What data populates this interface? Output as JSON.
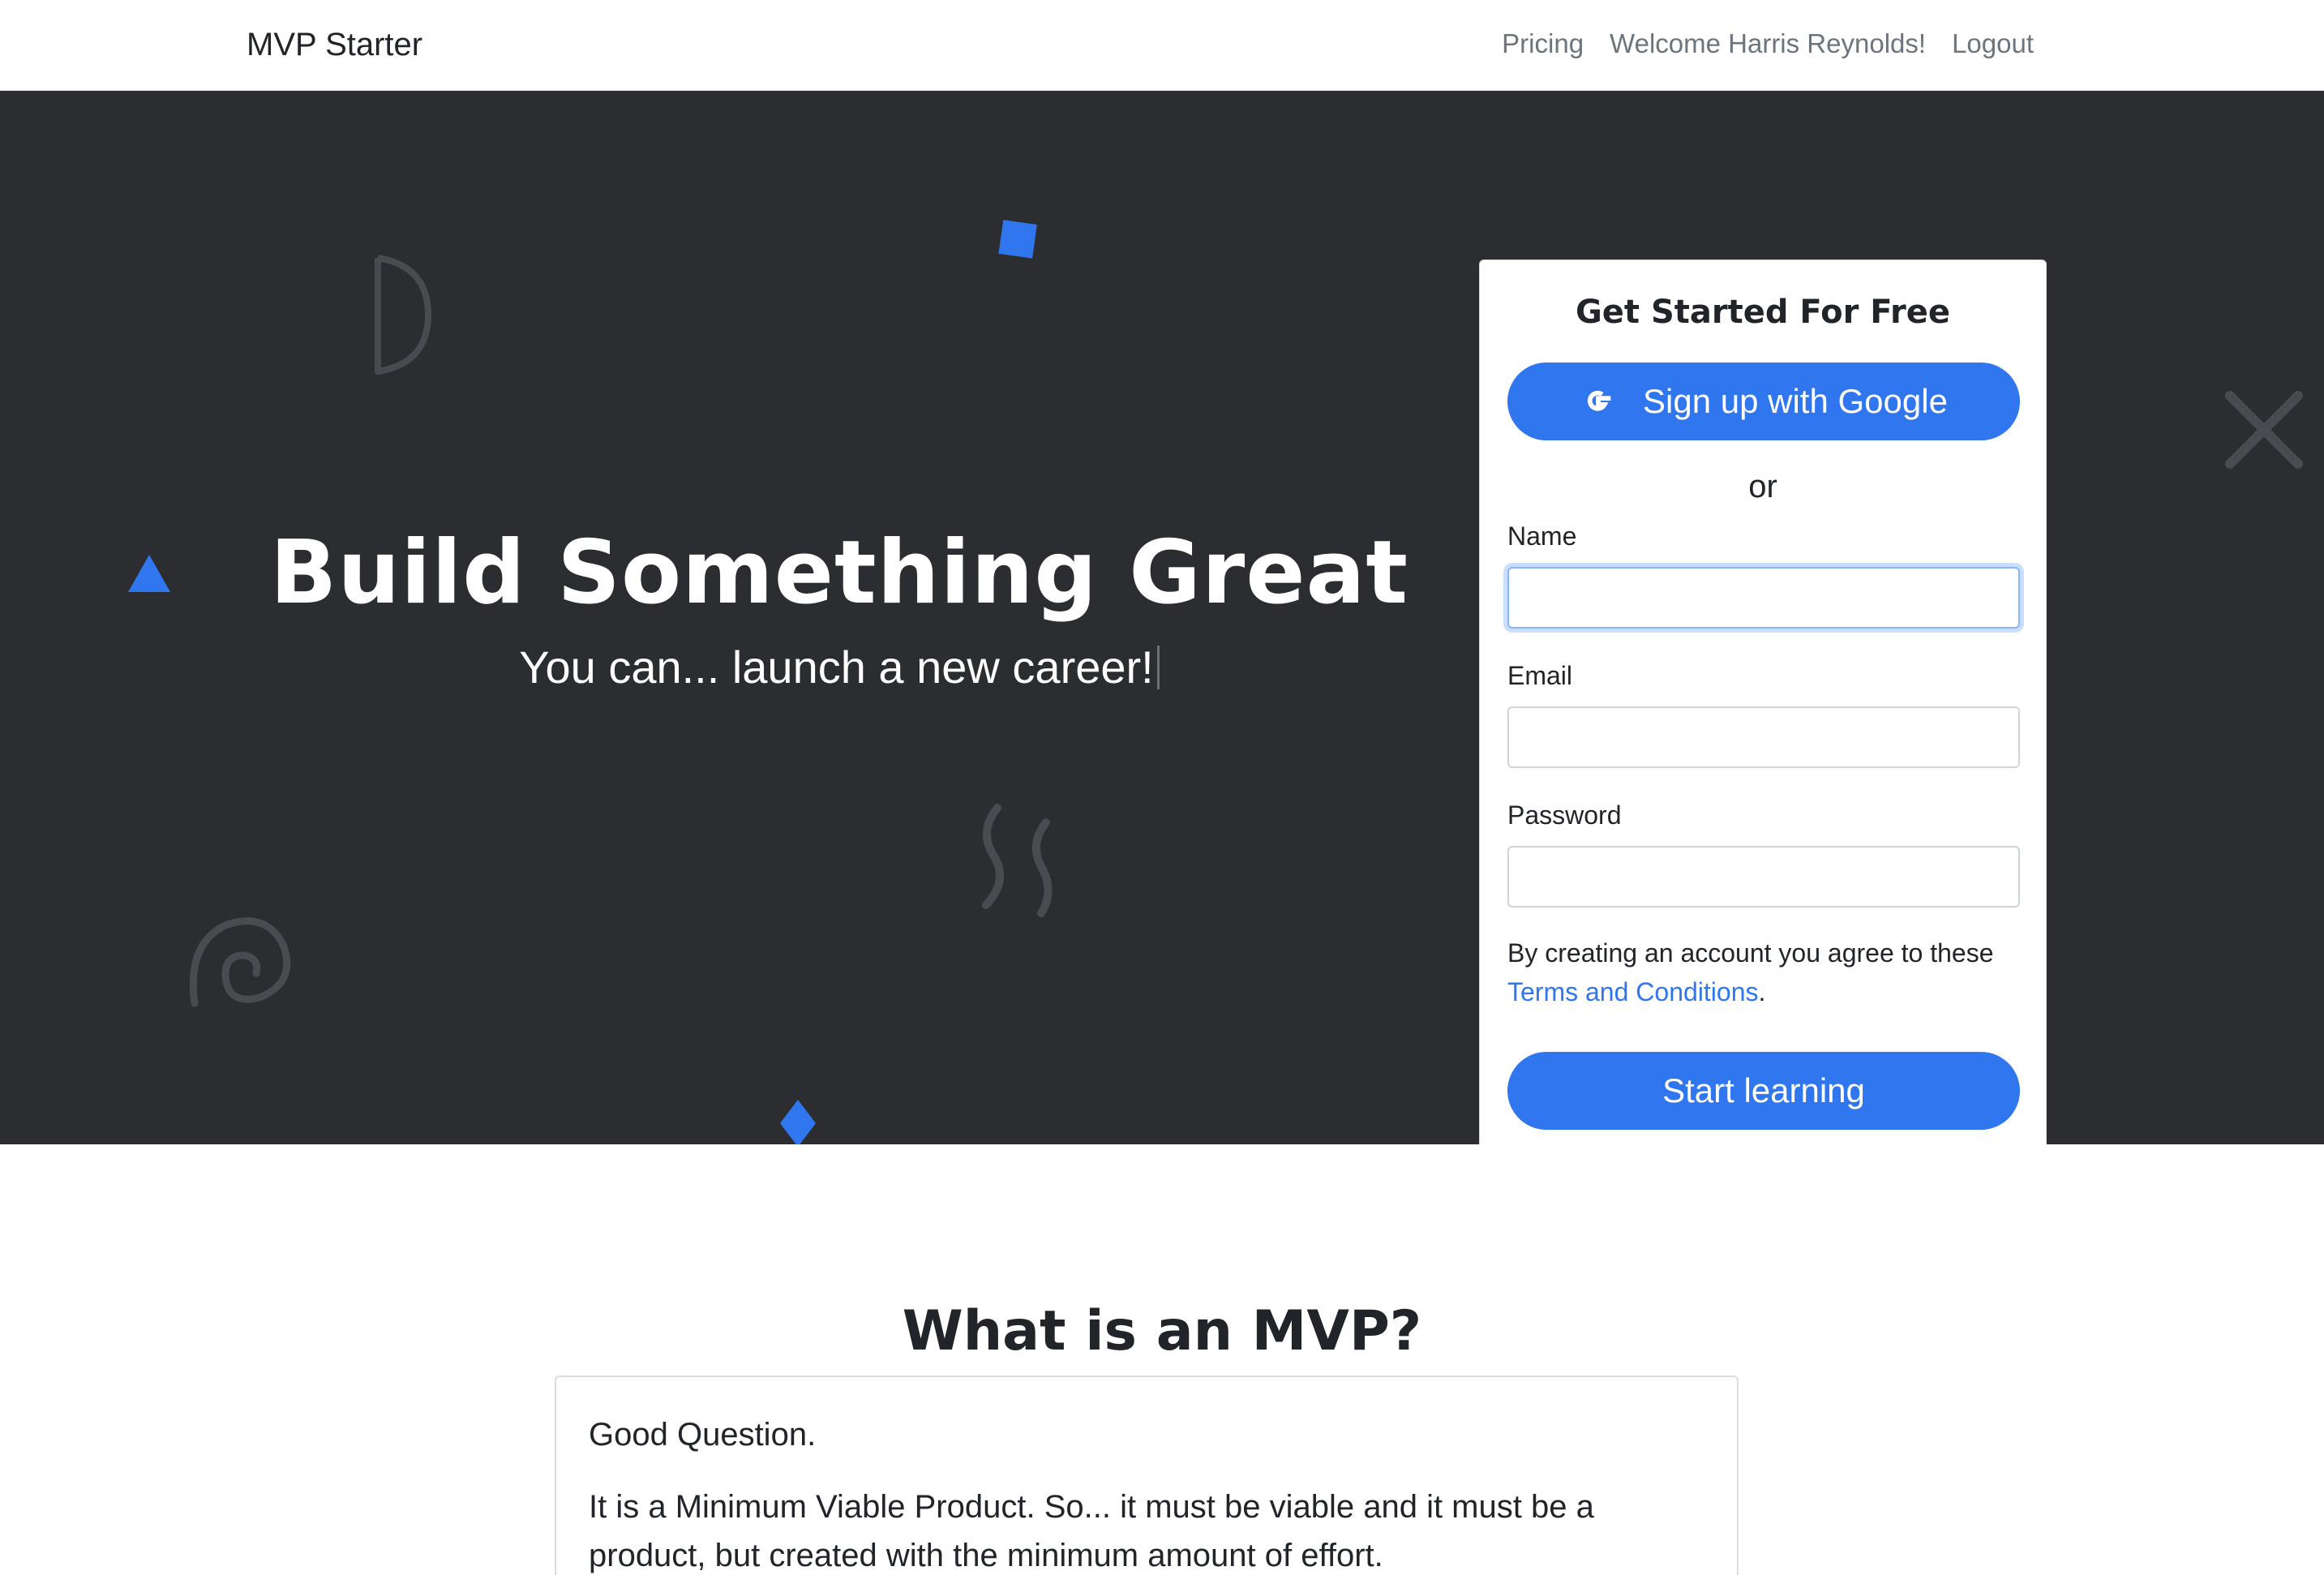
{
  "navbar": {
    "brand": "MVP Starter",
    "links": [
      {
        "label": "Pricing"
      },
      {
        "label": "Welcome Harris Reynolds!"
      },
      {
        "label": "Logout"
      }
    ]
  },
  "hero": {
    "title": "Build Something Great",
    "subtitle": "You can... launch a new career!"
  },
  "signup": {
    "title": "Get Started For Free",
    "google_button": "Sign up with Google",
    "or": "or",
    "name_label": "Name",
    "name_value": "",
    "email_label": "Email",
    "email_value": "",
    "password_label": "Password",
    "password_value": "",
    "agree_text": "By creating an account you agree to these",
    "terms_link": "Terms and Conditions",
    "agree_end": ".",
    "submit": "Start learning"
  },
  "mvp_section": {
    "title": "What is an MVP?",
    "p1": "Good Question.",
    "p2": "It is a Minimum Viable Product. So... it must be viable and it must be a product, but created with the minimum amount of effort."
  },
  "colors": {
    "accent": "#2f76ef",
    "hero_bg": "#2c2d31",
    "deco_gray": "#4a4b50"
  },
  "icons": [
    "google-icon"
  ]
}
